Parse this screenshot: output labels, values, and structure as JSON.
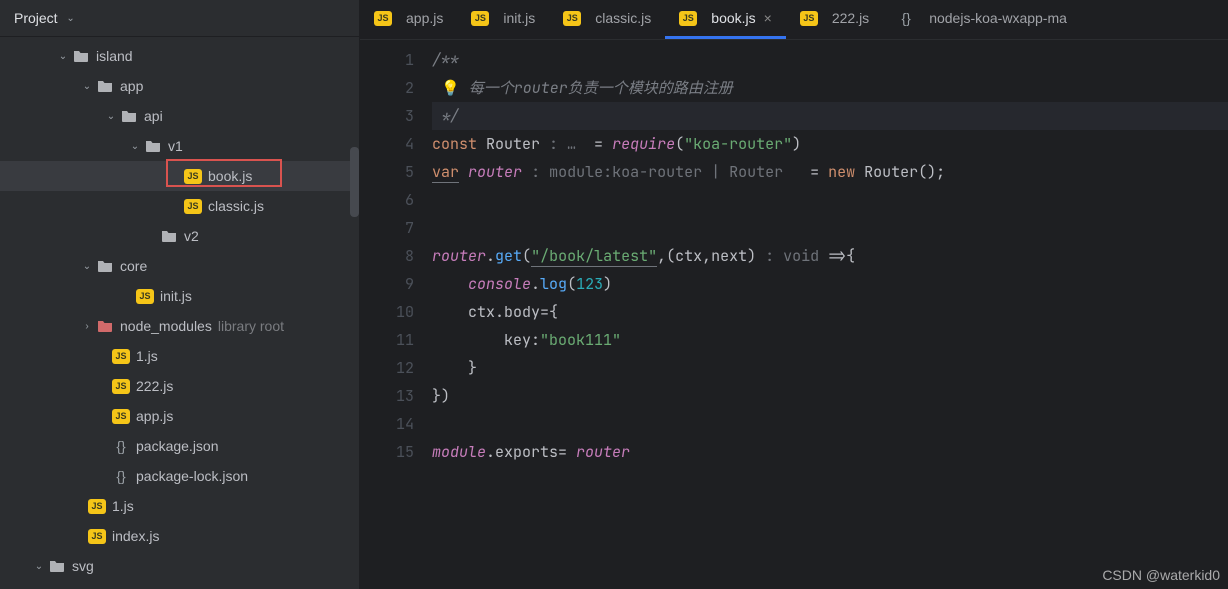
{
  "sidebar": {
    "header": "Project",
    "tree": [
      {
        "indent": 56,
        "chev": "v",
        "icon": "folder",
        "label": "island"
      },
      {
        "indent": 80,
        "chev": "v",
        "icon": "folder",
        "label": "app"
      },
      {
        "indent": 104,
        "chev": "v",
        "icon": "folder",
        "label": "api"
      },
      {
        "indent": 128,
        "chev": "v",
        "icon": "folder",
        "label": "v1"
      },
      {
        "indent": 168,
        "chev": "",
        "icon": "js",
        "label": "book.js",
        "selected": true,
        "boxed": true
      },
      {
        "indent": 168,
        "chev": "",
        "icon": "js",
        "label": "classic.js"
      },
      {
        "indent": 144,
        "chev": "",
        "icon": "folder",
        "label": "v2"
      },
      {
        "indent": 80,
        "chev": "v",
        "icon": "folder",
        "label": "core"
      },
      {
        "indent": 120,
        "chev": "",
        "icon": "js",
        "label": "init.js"
      },
      {
        "indent": 80,
        "chev": ">",
        "icon": "folder-ex",
        "label": "node_modules",
        "suffix": "library root"
      },
      {
        "indent": 96,
        "chev": "",
        "icon": "js",
        "label": "1.js"
      },
      {
        "indent": 96,
        "chev": "",
        "icon": "js",
        "label": "222.js"
      },
      {
        "indent": 96,
        "chev": "",
        "icon": "js",
        "label": "app.js"
      },
      {
        "indent": 96,
        "chev": "",
        "icon": "json",
        "label": "package.json"
      },
      {
        "indent": 96,
        "chev": "",
        "icon": "json",
        "label": "package-lock.json"
      },
      {
        "indent": 72,
        "chev": "",
        "icon": "js",
        "label": "1.js"
      },
      {
        "indent": 72,
        "chev": "",
        "icon": "js",
        "label": "index.js"
      },
      {
        "indent": 32,
        "chev": "v",
        "icon": "folder",
        "label": "svg"
      }
    ]
  },
  "tabs": [
    {
      "icon": "js",
      "label": "app.js"
    },
    {
      "icon": "js",
      "label": "init.js"
    },
    {
      "icon": "js",
      "label": "classic.js"
    },
    {
      "icon": "js",
      "label": "book.js",
      "active": true,
      "close": true
    },
    {
      "icon": "js",
      "label": "222.js"
    },
    {
      "icon": "json",
      "label": "nodejs-koa-wxapp-ma"
    }
  ],
  "code": {
    "lines": [
      {
        "n": 1,
        "html": "<span class='c-comment'>/**</span>"
      },
      {
        "n": 2,
        "html": " <span class='bulb'>💡</span><span class='c-comment'> 每一个router负责一个模块的路由注册</span>"
      },
      {
        "n": 3,
        "html": " <span class='c-comment'>*/</span>",
        "cursor": true
      },
      {
        "n": 4,
        "html": "<span class='c-kw'>const</span> Router <span class='c-hint'>: …  </span>= <span class='c-var'>require</span>(<span class='c-str'>\"koa-router\"</span>)"
      },
      {
        "n": 5,
        "html": "<span class='c-kw c-under'>var</span> <span class='c-var'>router</span> <span class='c-hint'>: module:koa-router | Router  </span> = <span class='c-kw'>new</span> Router();"
      },
      {
        "n": 6,
        "html": ""
      },
      {
        "n": 7,
        "html": ""
      },
      {
        "n": 8,
        "html": "<span class='c-var'>router</span>.<span class='c-fn'>get</span>(<span class='c-str c-under'>\"/book/latest\"</span>,(ctx,next) <span class='c-hint'>: void </span>=>{"
      },
      {
        "n": 9,
        "html": "    <span class='c-var'>console</span>.<span class='c-fn'>log</span>(<span class='c-num'>123</span>)"
      },
      {
        "n": 10,
        "html": "    ctx.body={"
      },
      {
        "n": 11,
        "html": "        key:<span class='c-str'>\"book111\"</span>"
      },
      {
        "n": 12,
        "html": "    }"
      },
      {
        "n": 13,
        "html": "})"
      },
      {
        "n": 14,
        "html": ""
      },
      {
        "n": 15,
        "html": "<span class='c-var'>module</span>.exports= <span class='c-var'>router</span>"
      }
    ]
  },
  "watermark": "CSDN @waterkid0"
}
